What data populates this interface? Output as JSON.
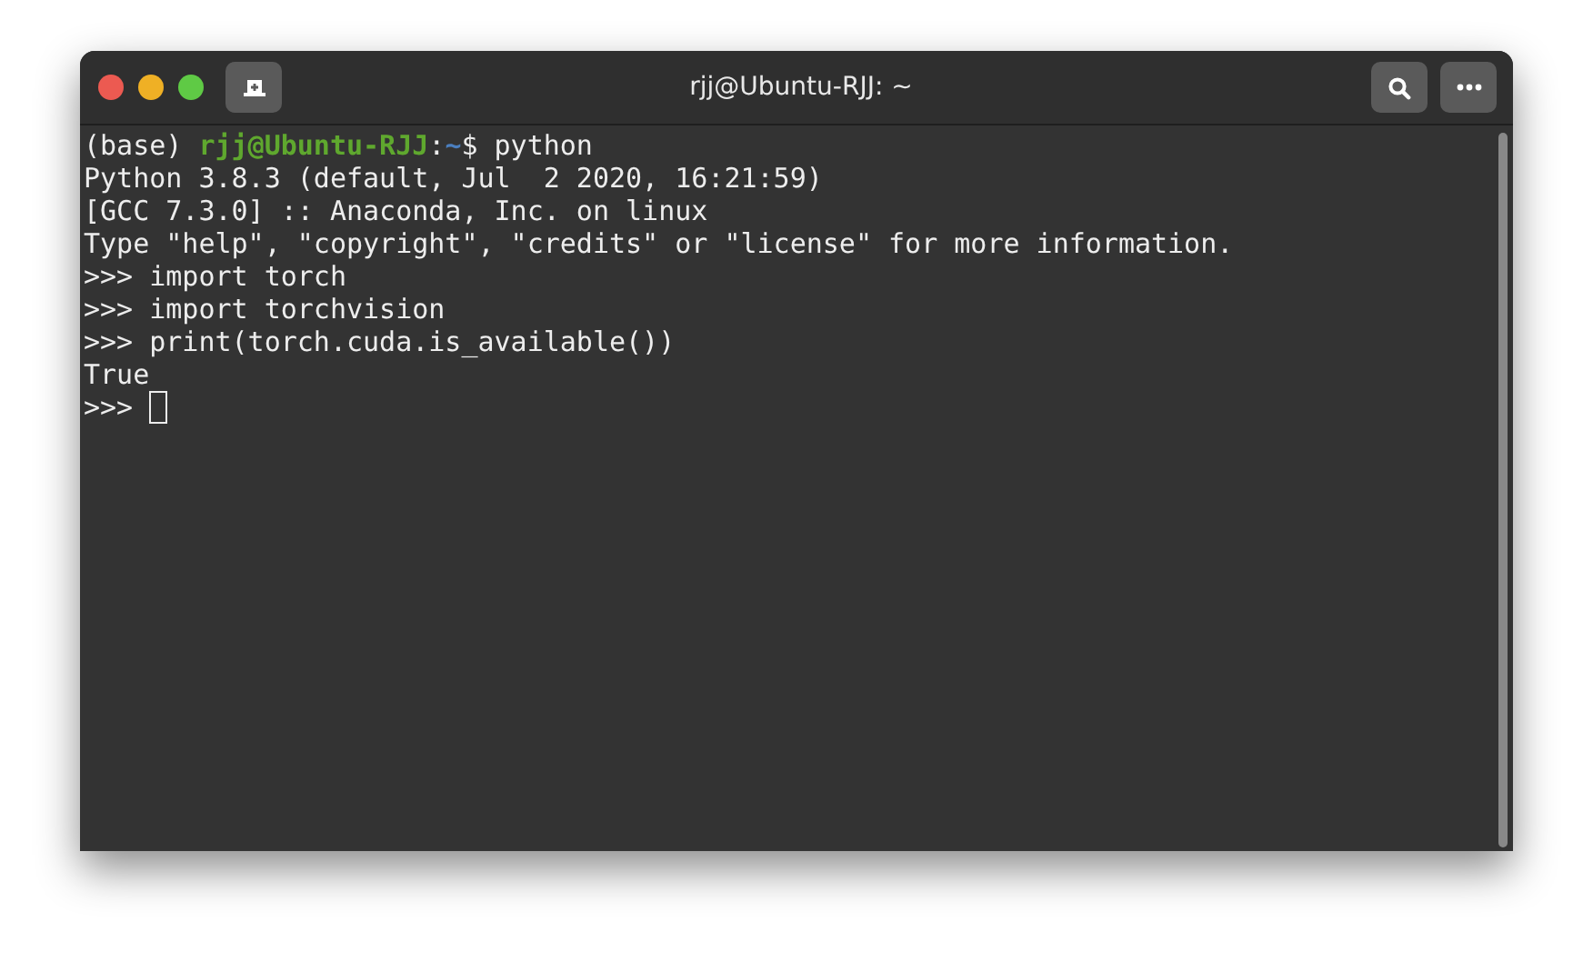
{
  "window": {
    "title": "rjj@Ubuntu-RJJ: ~"
  },
  "terminal": {
    "lines": [
      {
        "segments": [
          {
            "text": "(base) ",
            "kind": "plain"
          },
          {
            "text": "rjj@Ubuntu-RJJ",
            "kind": "user"
          },
          {
            "text": ":",
            "kind": "plain"
          },
          {
            "text": "~",
            "kind": "path"
          },
          {
            "text": "$ python",
            "kind": "plain"
          }
        ]
      },
      {
        "segments": [
          {
            "text": "Python 3.8.3 (default, Jul  2 2020, 16:21:59)",
            "kind": "plain"
          }
        ]
      },
      {
        "segments": [
          {
            "text": "[GCC 7.3.0] :: Anaconda, Inc. on linux",
            "kind": "plain"
          }
        ]
      },
      {
        "segments": [
          {
            "text": "Type \"help\", \"copyright\", \"credits\" or \"license\" for more information.",
            "kind": "plain"
          }
        ]
      },
      {
        "segments": [
          {
            "text": ">>> import torch",
            "kind": "plain"
          }
        ]
      },
      {
        "segments": [
          {
            "text": ">>> import torchvision",
            "kind": "plain"
          }
        ]
      },
      {
        "segments": [
          {
            "text": ">>> print(torch.cuda.is_available())",
            "kind": "plain"
          }
        ]
      },
      {
        "segments": [
          {
            "text": "True",
            "kind": "plain"
          }
        ]
      },
      {
        "segments": [
          {
            "text": ">>> ",
            "kind": "plain"
          }
        ],
        "cursor": true
      }
    ]
  }
}
